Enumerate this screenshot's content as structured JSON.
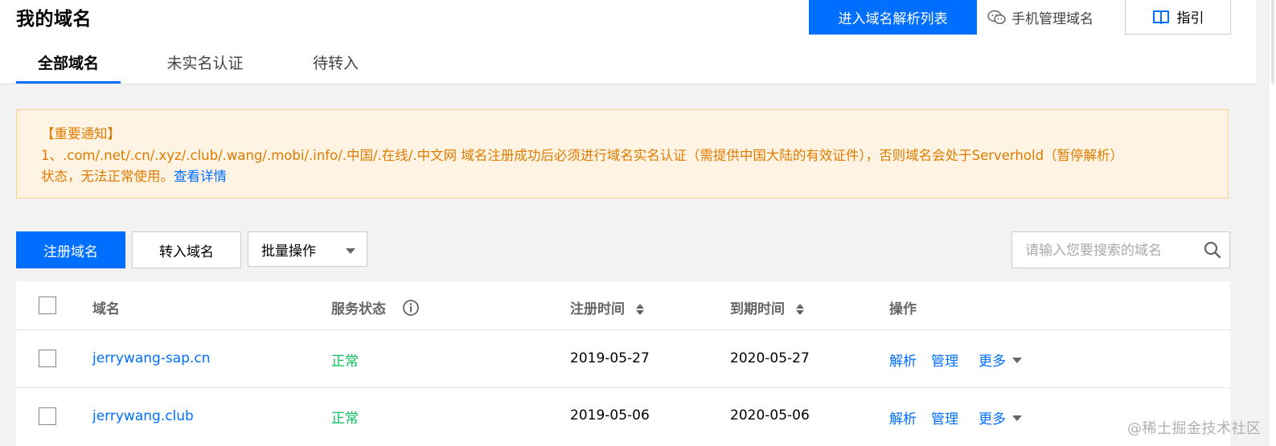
{
  "header": {
    "title": "我的域名",
    "dns_list_button": "进入域名解析列表",
    "mobile_manage_label": "手机管理域名",
    "guide_label": "指引"
  },
  "tabs": [
    {
      "label": "全部域名",
      "active": true
    },
    {
      "label": "未实名认证",
      "active": false
    },
    {
      "label": "待转入",
      "active": false
    }
  ],
  "notice": {
    "title": "【重要通知】",
    "line1": "1、.com/.net/.cn/.xyz/.club/.wang/.mobi/.info/.中国/.在线/.中文网 域名注册成功后必须进行域名实名认证（需提供中国大陆的有效证件），否则域名会处于Serverhold（暂停解析）",
    "line2": "状态，无法正常使用。",
    "link": "查看详情"
  },
  "toolbar": {
    "register_label": "注册域名",
    "transfer_label": "转入域名",
    "batch_label": "批量操作",
    "search_placeholder": "请输入您要搜索的域名"
  },
  "table": {
    "columns": {
      "domain": "域名",
      "status": "服务状态",
      "reg_time": "注册时间",
      "exp_time": "到期时间",
      "ops": "操作"
    },
    "rows": [
      {
        "domain": "jerrywang-sap.cn",
        "status": "正常",
        "reg": "2019-05-27",
        "exp": "2020-05-27",
        "op_resolve": "解析",
        "op_manage": "管理",
        "op_more": "更多"
      },
      {
        "domain": "jerrywang.club",
        "status": "正常",
        "reg": "2019-05-06",
        "exp": "2020-05-06",
        "op_resolve": "解析",
        "op_manage": "管理",
        "op_more": "更多"
      }
    ]
  },
  "watermark": "@稀土掘金技术社区",
  "colors": {
    "accent": "#006eff",
    "notice_text": "#e07b00",
    "notice_bg": "#fff4e3",
    "status_ok": "#0abf5b"
  }
}
